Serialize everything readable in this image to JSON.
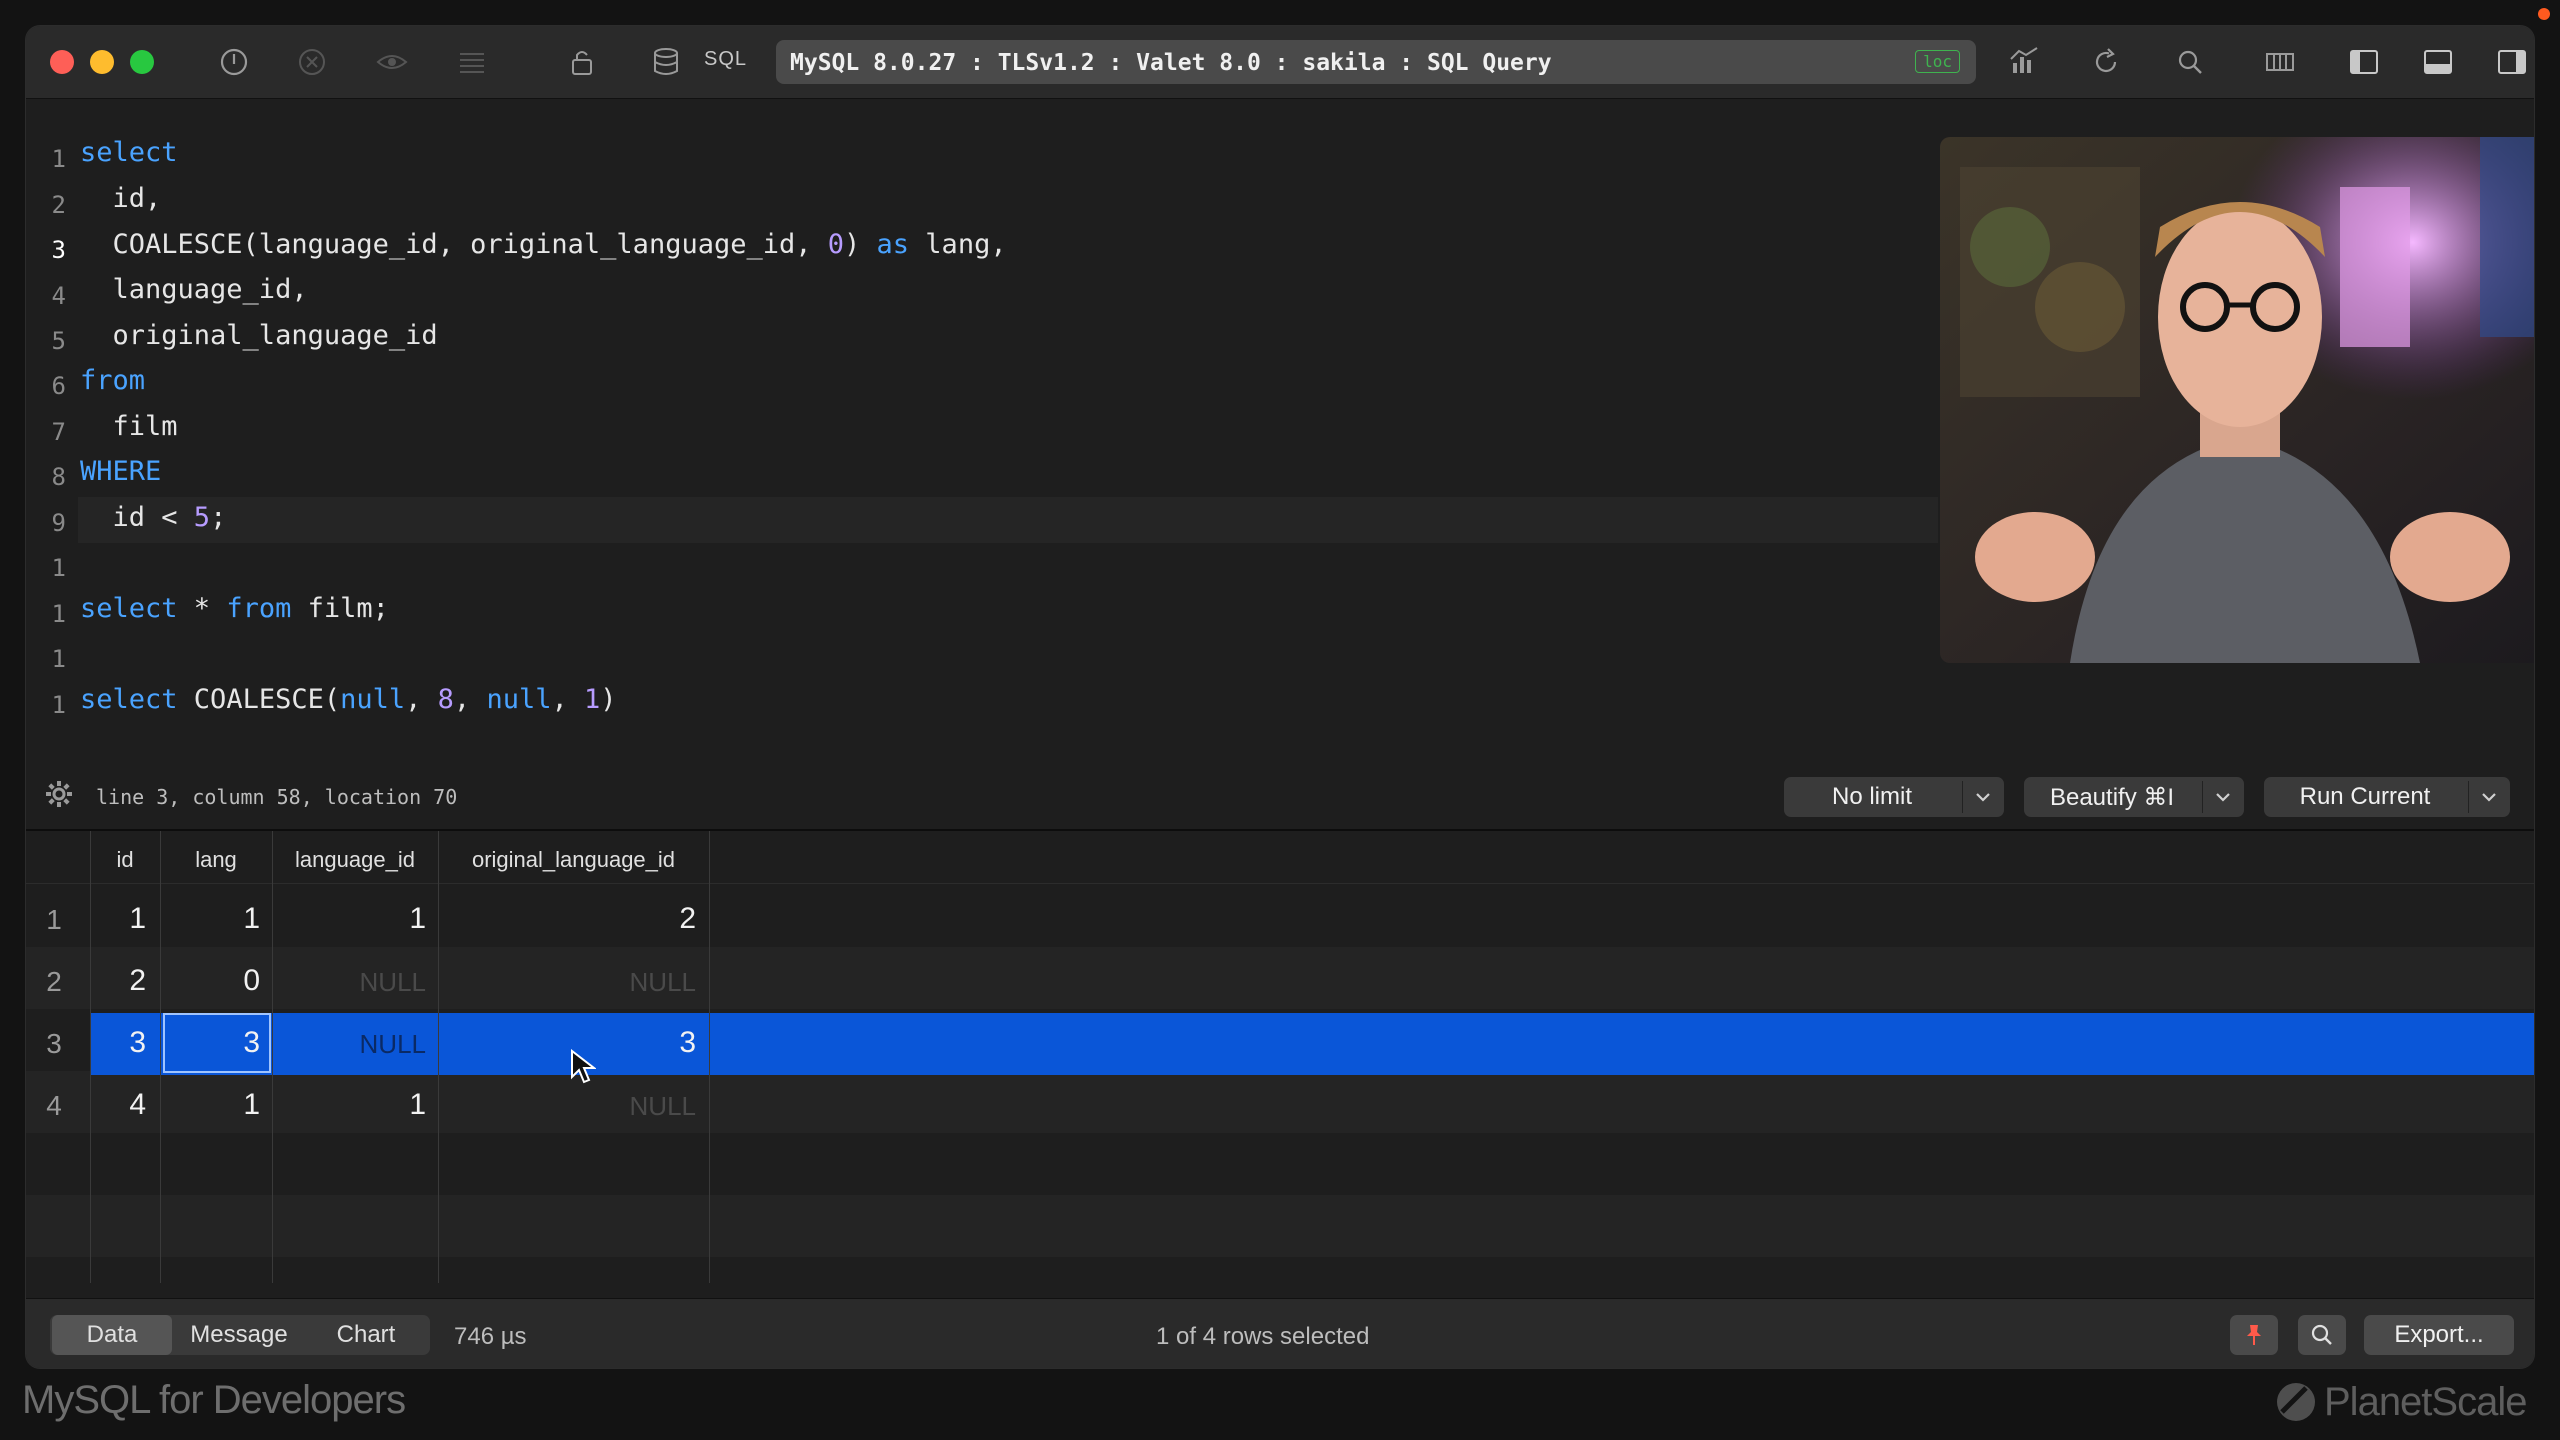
{
  "toolbar": {
    "sql_label": "SQL",
    "connection": "MySQL 8.0.27 : TLSv1.2 : Valet 8.0 : sakila : SQL Query",
    "loc_badge": "loc"
  },
  "editor": {
    "line_numbers": [
      "1",
      "2",
      "3",
      "4",
      "5",
      "6",
      "7",
      "8",
      "9",
      "1",
      "1",
      "1",
      "1"
    ],
    "active_line": 3,
    "cursor_info": "line 3, column 58, location 70"
  },
  "query_controls": {
    "limit": "No limit",
    "beautify": "Beautify ⌘I",
    "run": "Run Current"
  },
  "results": {
    "columns": [
      "id",
      "lang",
      "language_id",
      "original_language_id"
    ],
    "row_numbers": [
      "1",
      "2",
      "3",
      "4"
    ],
    "rows": [
      [
        "1",
        "1",
        "1",
        "2"
      ],
      [
        "2",
        "0",
        "NULL",
        "NULL"
      ],
      [
        "3",
        "3",
        "NULL",
        "3"
      ],
      [
        "4",
        "1",
        "1",
        "NULL"
      ]
    ],
    "selected_row": 3
  },
  "footer": {
    "tabs": [
      "Data",
      "Message",
      "Chart"
    ],
    "active_tab": "Data",
    "timing": "746 µs",
    "selection": "1 of 4 rows selected",
    "export_label": "Export..."
  },
  "overlay": {
    "course_title": "MySQL for Developers",
    "brand": "PlanetScale"
  },
  "colors": {
    "keyword": "#4aa3ff",
    "number": "#b79cff",
    "selection": "#0a56d8",
    "loc_green": "#3fb34f"
  }
}
